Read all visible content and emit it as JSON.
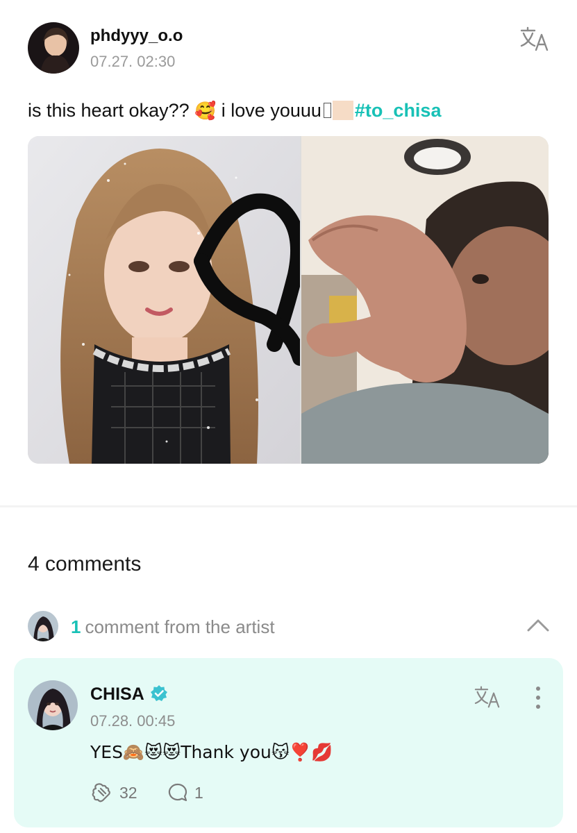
{
  "post": {
    "username": "phdyyy_o.o",
    "timestamp": "07.27. 02:30",
    "text_part1": "is this heart okay??",
    "emoji1": "🥰",
    "text_part2": "i love youuu",
    "hashtag": "#to_chisa"
  },
  "comments_section": {
    "count_label": "4 comments",
    "artist_count": "1",
    "artist_label": "comment from the artist"
  },
  "artist_comment": {
    "name": "CHISA",
    "timestamp": "07.28. 00:45",
    "text": "YES🙈😻😻Thank you😽❣️💋",
    "likes": "32",
    "replies": "1"
  },
  "colors": {
    "accent": "#18c1b6",
    "card_bg": "#e5fbf6",
    "muted": "#8a8a8a"
  },
  "icons": [
    "translate-icon",
    "chevron-up-icon",
    "verified-badge-icon",
    "more-vertical-icon",
    "like-icon",
    "comment-icon"
  ]
}
